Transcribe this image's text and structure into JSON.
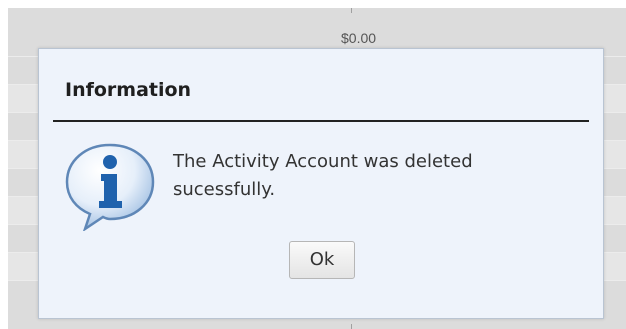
{
  "background": {
    "amount": "$0.00"
  },
  "dialog": {
    "title": "Information",
    "icon": "info-icon",
    "message": "The Activity Account was deleted sucessfully.",
    "ok_label": "Ok"
  },
  "colors": {
    "dialog_background": "#eef3fb",
    "icon_blue": "#2a6fb8"
  }
}
